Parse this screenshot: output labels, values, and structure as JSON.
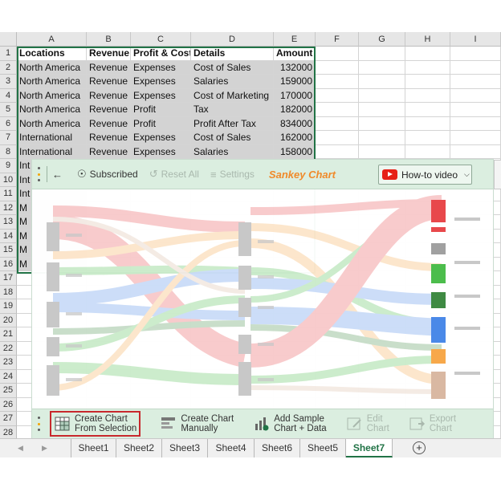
{
  "columns": [
    "A",
    "B",
    "C",
    "D",
    "E",
    "F",
    "G",
    "H",
    "I"
  ],
  "rows": [
    "1",
    "2",
    "3",
    "4",
    "5",
    "6",
    "7",
    "8",
    "9",
    "10",
    "11",
    "12",
    "13",
    "14",
    "15",
    "16",
    "17",
    "18",
    "19",
    "20",
    "21",
    "22",
    "23",
    "24",
    "25",
    "26",
    "27",
    "28"
  ],
  "table": {
    "headers": [
      "Locations",
      "Revenue",
      "Profit & Cost",
      "Details",
      "Amount"
    ],
    "rows": [
      [
        "North America",
        "Revenue",
        "Expenses",
        "Cost of Sales",
        "132000"
      ],
      [
        "North America",
        "Revenue",
        "Expenses",
        "Salaries",
        "159000"
      ],
      [
        "North America",
        "Revenue",
        "Expenses",
        "Cost of Marketing",
        "170000"
      ],
      [
        "North America",
        "Revenue",
        "Profit",
        "Tax",
        "182000"
      ],
      [
        "North America",
        "Revenue",
        "Profit",
        "Profit After Tax",
        "834000"
      ],
      [
        "International",
        "Revenue",
        "Expenses",
        "Cost of Sales",
        "162000"
      ],
      [
        "International",
        "Revenue",
        "Expenses",
        "Salaries",
        "158000"
      ]
    ],
    "partial_rows": [
      "Int",
      "Int",
      "Int",
      "M",
      "M",
      "M",
      "M",
      "M"
    ]
  },
  "addin": {
    "subscribed": "Subscribed",
    "reset_all": "Reset All",
    "settings": "Settings",
    "title": "Sankey Chart",
    "howto": "How-to video",
    "bottom": {
      "create_from_selection": [
        "Create Chart",
        "From Selection"
      ],
      "create_manually": [
        "Create Chart",
        "Manually"
      ],
      "add_sample": [
        "Add Sample",
        "Chart + Data"
      ],
      "edit_chart": [
        "Edit",
        "Chart"
      ],
      "export_chart": [
        "Export",
        "Chart"
      ]
    }
  },
  "colors": {
    "excel_green": "#217346",
    "title_orange": "#f08a2a",
    "node_red": "#e8484b",
    "node_green": "#4cbd4c",
    "node_darkgreen": "#3f8a43",
    "node_blue": "#4a89e8",
    "node_orange": "#f7a84a",
    "node_tan": "#d9b8a2"
  },
  "sheets": [
    "Sheet1",
    "Sheet2",
    "Sheet3",
    "Sheet4",
    "Sheet6",
    "Sheet5",
    "Sheet7"
  ],
  "active_sheet": "Sheet7"
}
